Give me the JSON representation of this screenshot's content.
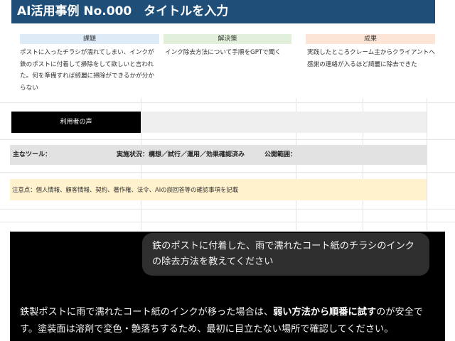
{
  "sheet": {
    "title": "AI活用事例 No.000　タイトルを入力",
    "columns": [
      {
        "header": "課題",
        "text": "ポストに入ったチラシが濡れてしまい、インクが鉄のポストに付着して掃除をして欲しいと言われた。何を準備すれば綺麗に掃除ができるかが分からない",
        "header_color": "#ddebf7"
      },
      {
        "header": "解決策",
        "text": "インク除去方法について手順をGPTで聞く",
        "header_color": "#e2efda"
      },
      {
        "header": "成果",
        "text": "実践したところクレーム主からクライアントへ感謝の連絡が入るほど綺麗に除去できた",
        "header_color": "#fce4d6"
      }
    ],
    "voice_label": "利用者の声",
    "tools_label": "主なツール：",
    "status_label": "実施状況：構想／試行／運用／効果確認済み",
    "scope_label": "公開範囲：",
    "note": "注意点：個人情報、顧客情報、契約、著作権、法令、AIの誤回答等の確認事項を記載"
  },
  "chat": {
    "user_message": "鉄のポストに付着した、雨で濡れたコート紙のチラシのインクの除去方法を教えてください",
    "answer_part1": "鉄製ポストに雨で濡れたコート紙のインクが移った場合は、",
    "answer_bold": "弱い方法から順番に試す",
    "answer_part2": "のが安全です。塗装面は溶剤で変色・艶落ちするため、最初に目立たない場所で確認してください。"
  }
}
